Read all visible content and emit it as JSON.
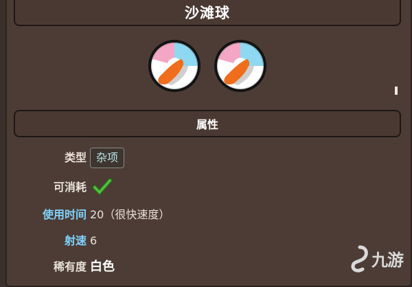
{
  "item": {
    "name": "沙滩球",
    "mark": "1"
  },
  "section": {
    "title": "属性"
  },
  "attributes": {
    "type_label": "类型",
    "type_value": "杂项",
    "consumable_label": "可消耗",
    "use_time_label": "使用时间",
    "use_time_value": "20（很快速度）",
    "velocity_label": "射速",
    "velocity_value": "6",
    "rarity_label": "稀有度",
    "rarity_value": "白色"
  },
  "icons": [
    "beach-ball-sprite",
    "checkmark-icon",
    "logo-icon"
  ],
  "colors": {
    "background": "#4d3c35",
    "header_bar": "#4a3832",
    "highlight_label": "#7fd3ff",
    "check_green": "#4ec23a"
  },
  "watermark": {
    "text": "九游"
  }
}
